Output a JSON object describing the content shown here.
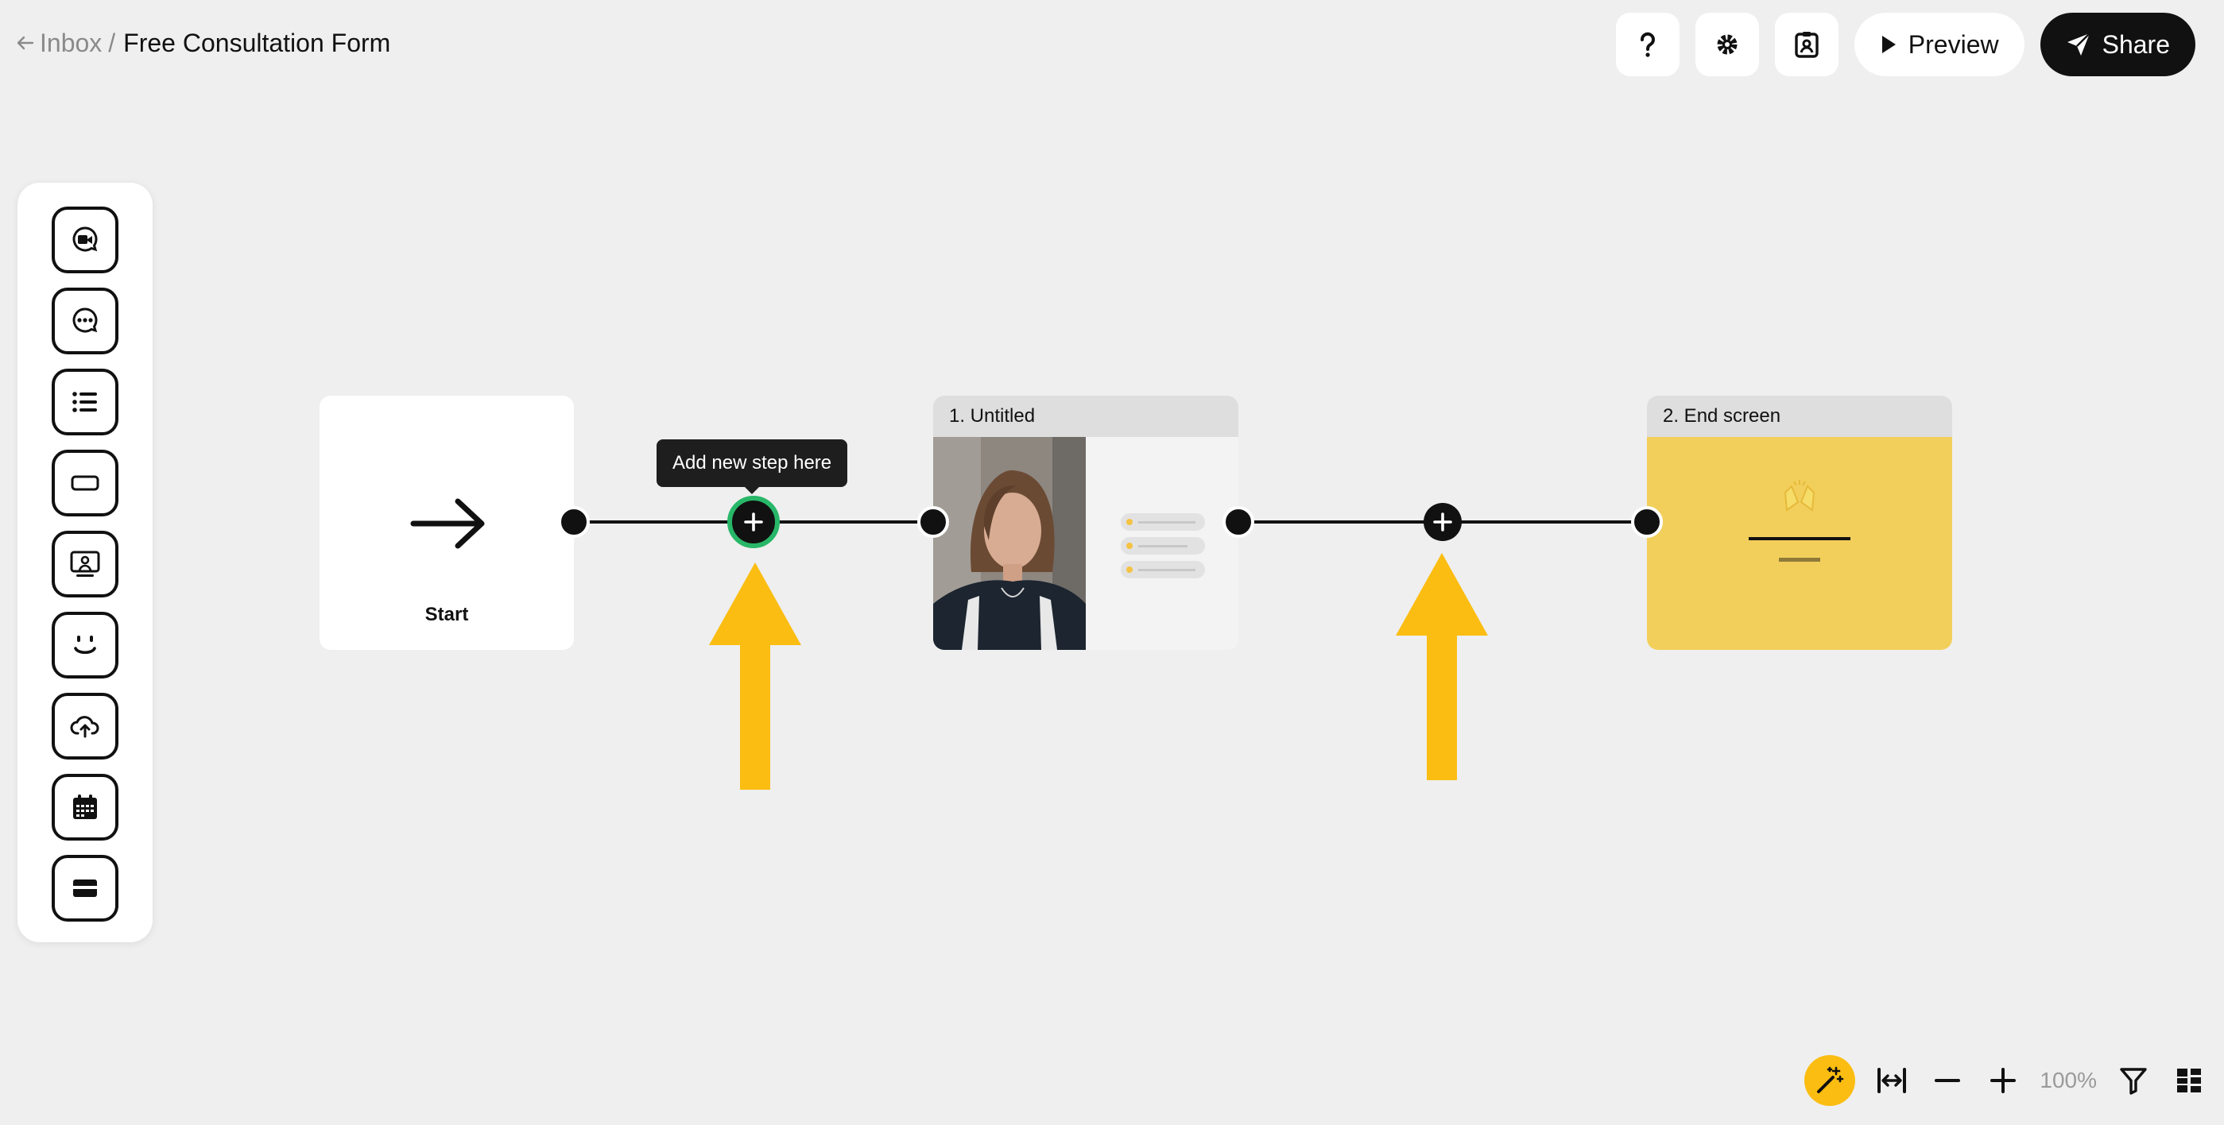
{
  "header": {
    "back_icon": "arrow-left-icon",
    "breadcrumb_parent": "Inbox",
    "breadcrumb_separator": "/",
    "title": "Free Consultation Form",
    "help_icon": "question-mark-icon",
    "settings_icon": "gear-icon",
    "contact_icon": "contact-card-icon",
    "preview_label": "Preview",
    "share_label": "Share"
  },
  "toolbar": {
    "tools": [
      {
        "icon": "video-message-icon"
      },
      {
        "icon": "chat-bubble-icon"
      },
      {
        "icon": "list-icon"
      },
      {
        "icon": "button-rectangle-icon"
      },
      {
        "icon": "screen-presenter-icon"
      },
      {
        "icon": "smiley-face-icon"
      },
      {
        "icon": "cloud-upload-icon"
      },
      {
        "icon": "calendar-icon"
      },
      {
        "icon": "credit-card-icon"
      }
    ]
  },
  "canvas": {
    "start_label": "Start",
    "step1_title": "1. Untitled",
    "step2_title": "2. End screen",
    "tooltip": "Add new step here",
    "end_screen_color": "#f2cf5b",
    "arrow_color": "#fbbd12",
    "highlight_ring_color": "#28b768"
  },
  "controls": {
    "zoom_level": "100%",
    "magic_icon": "magic-wand-icon",
    "fit_icon": "fit-width-icon",
    "zoom_out_icon": "minus-icon",
    "zoom_in_icon": "plus-icon",
    "filter_icon": "filter-icon",
    "layout_icon": "grid-layout-icon"
  }
}
